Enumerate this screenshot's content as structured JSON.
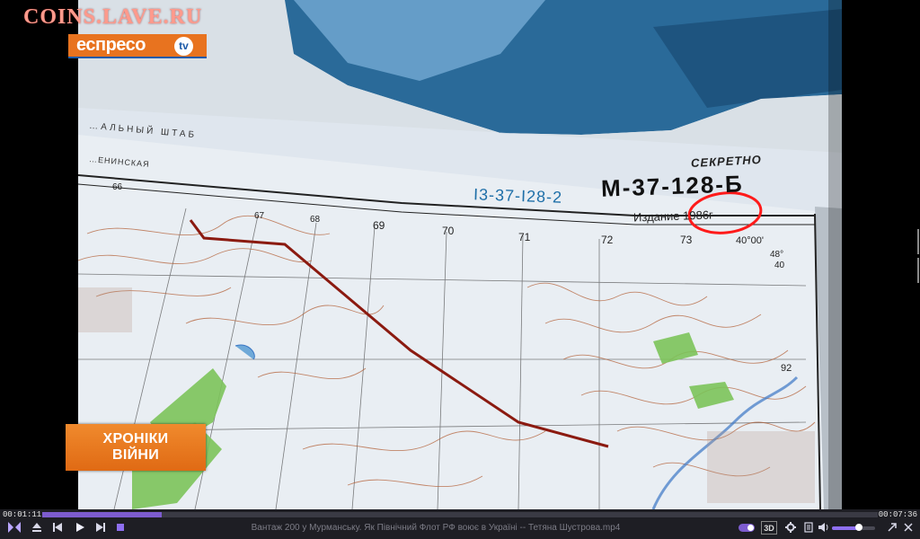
{
  "overlay": {
    "watermark": "COINS.LAVE.RU",
    "channel_logo": "еспресо",
    "channel_logo_badge": "tv",
    "lower_third_line1": "ХРОНІКИ",
    "lower_third_line2": "ВІЙНИ"
  },
  "map": {
    "secret_stamp": "СЕКРЕТНО",
    "sheet_code": "М-37-128-Б",
    "sheet_code_alt": "I3-37-I28-2",
    "edition": "Издание 1986г",
    "header_text": "…АЛЬНЫЙ ШТАБ",
    "header_sub": "…ЕНИНСКАЯ",
    "grid_numbers": [
      "66",
      "67",
      "68",
      "69",
      "70",
      "71",
      "72",
      "73"
    ],
    "coordinate": "40°00'",
    "coordinate2": "48°",
    "coordinate3": "40",
    "grid_side": "92"
  },
  "player": {
    "time_elapsed": "00:01:11",
    "time_total": "00:07:36",
    "progress": 0.143,
    "file_name": "Вантаж 200 у Мурманську. Як Північний Флот РФ воює в Україні -- Тетяна Шустрова.mp4",
    "btn_3d": "3D",
    "volume": 0.62,
    "icons": [
      "playlist-icon",
      "eject-icon",
      "prev-icon",
      "play-icon",
      "next-icon",
      "stop-icon",
      "toggle-icon",
      "3d-icon",
      "settings-icon",
      "menu-icon",
      "volume-icon",
      "expand-icon",
      "close-icon"
    ]
  },
  "colors": {
    "accent": "#7d5ccf",
    "logo_orange": "#e8731f",
    "logo_blue": "#1c5aa8",
    "route_red": "#8b1a10",
    "circle_red": "#ff1a1a"
  }
}
